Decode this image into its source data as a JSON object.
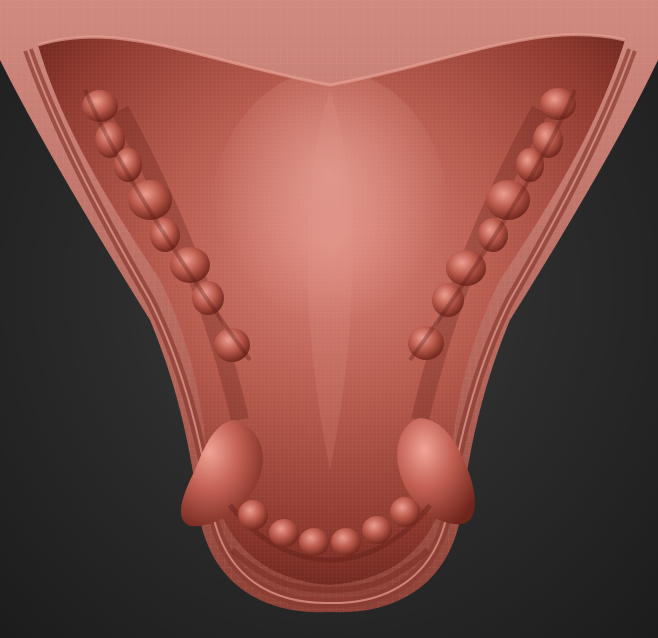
{
  "scene": {
    "subject": "sculpted-creature-palate-with-teeth",
    "colors": {
      "background_center": "#3e3e3e",
      "background_edge": "#1c1c1c",
      "clay_base": "#b4574a",
      "clay_highlight": "#df968a",
      "clay_shadow": "#5c1d16",
      "outer_skin": "#c87a70",
      "inner_rim": "#9a4036",
      "wire_grid": "#f2b6ad"
    },
    "teeth_count": {
      "left_row": 7,
      "right_row": 7,
      "front_row": 6,
      "large_fangs": 2
    }
  }
}
